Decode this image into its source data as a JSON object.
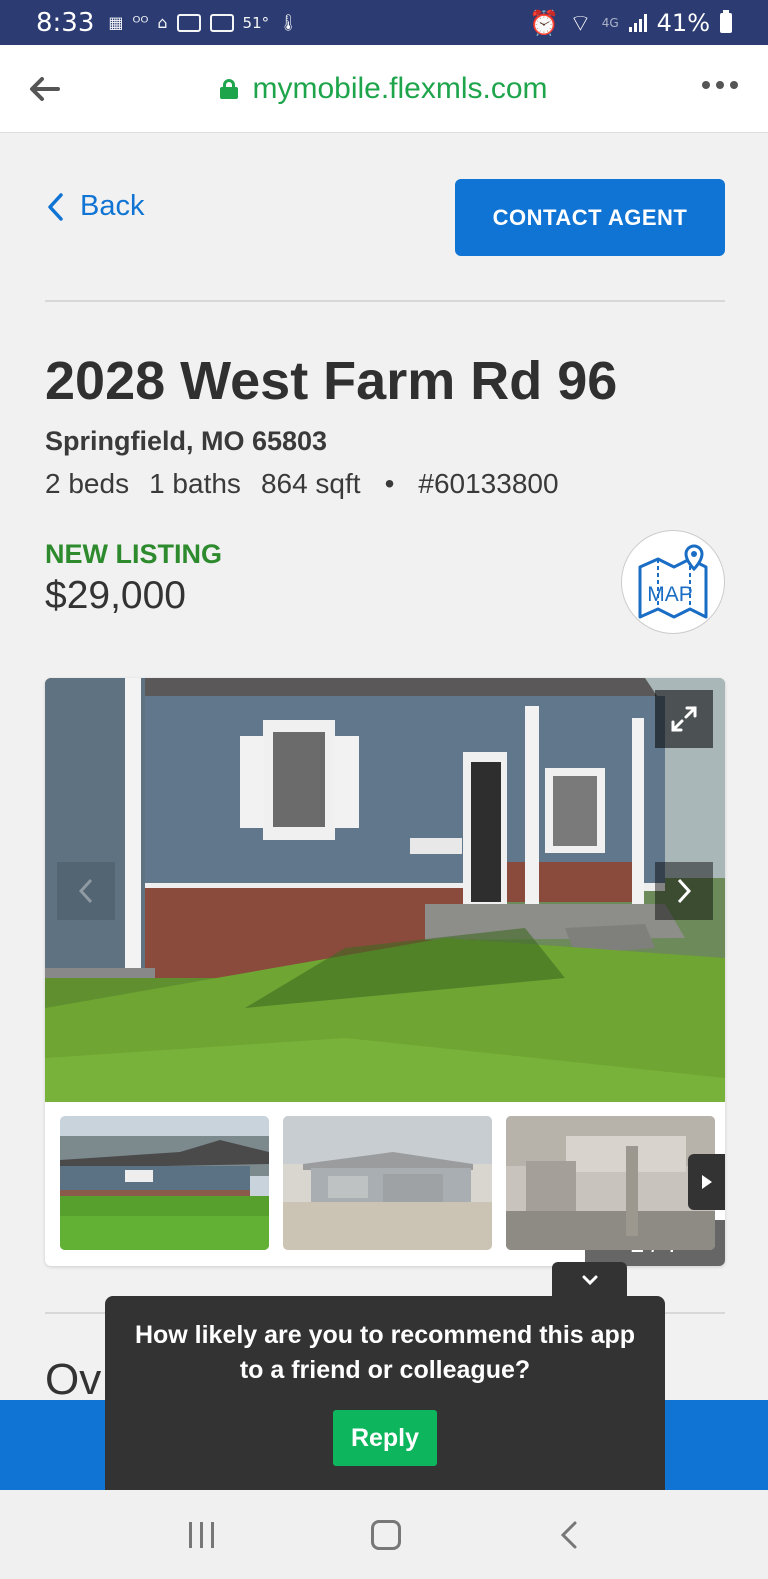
{
  "status_bar": {
    "time": "8:33",
    "temperature": "51°",
    "network": "4G",
    "battery": "41%"
  },
  "browser": {
    "url": "mymobile.flexmls.com"
  },
  "header": {
    "back_label": "Back",
    "contact_label": "CONTACT AGENT"
  },
  "listing": {
    "address": "2028 West Farm Rd 96",
    "city_state_zip": "Springfield, MO 65803",
    "beds": "2 beds",
    "baths": "1 baths",
    "sqft": "864 sqft",
    "separator": "•",
    "mls_number": "#60133800",
    "status": "NEW LISTING",
    "price": "$29,000",
    "map_label": "MAP"
  },
  "gallery": {
    "counter": "1 / 7",
    "thumbnail_count": 3
  },
  "section": {
    "overview_partial": "Ov"
  },
  "survey": {
    "question": "How likely are you to recommend this app to a friend or colleague?",
    "reply_label": "Reply"
  },
  "colors": {
    "status_bar": "#2c3c73",
    "primary_blue": "#0f74d4",
    "url_green": "#1ea54b",
    "listing_green": "#2d8a2d",
    "reply_green": "#0db55d",
    "survey_bg": "#333333"
  }
}
